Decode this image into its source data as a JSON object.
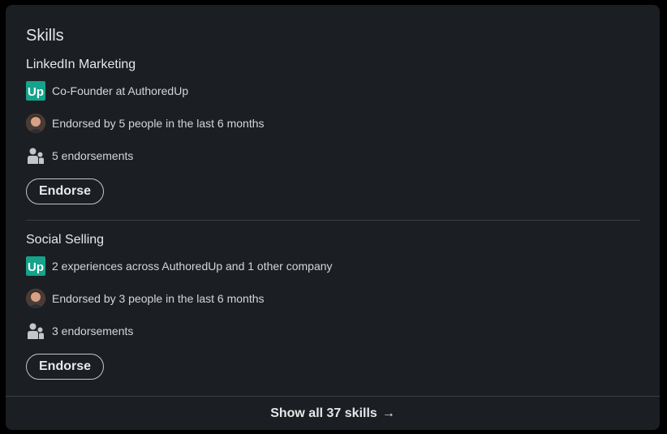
{
  "skills_section": {
    "title": "Skills",
    "skills": [
      {
        "name": "LinkedIn Marketing",
        "experience": "Co-Founder at AuthoredUp",
        "endorsed_by": "Endorsed by 5 people in the last 6 months",
        "endorsements": "5 endorsements",
        "endorse_label": "Endorse"
      },
      {
        "name": "Social Selling",
        "experience": "2 experiences across AuthoredUp and 1 other company",
        "endorsed_by": "Endorsed by 3 people in the last 6 months",
        "endorsements": "3 endorsements",
        "endorse_label": "Endorse"
      }
    ],
    "show_all_label": "Show all 37 skills",
    "show_all_arrow": "→"
  },
  "icons": {
    "company_logo": "authoredup-logo-icon",
    "avatar": "endorser-avatar",
    "people": "people-icon"
  },
  "colors": {
    "background": "#000000",
    "card": "#1b1f23",
    "logo_bg": "#14a38b",
    "text": "#e6e7e8",
    "divider": "#3a3f43"
  }
}
